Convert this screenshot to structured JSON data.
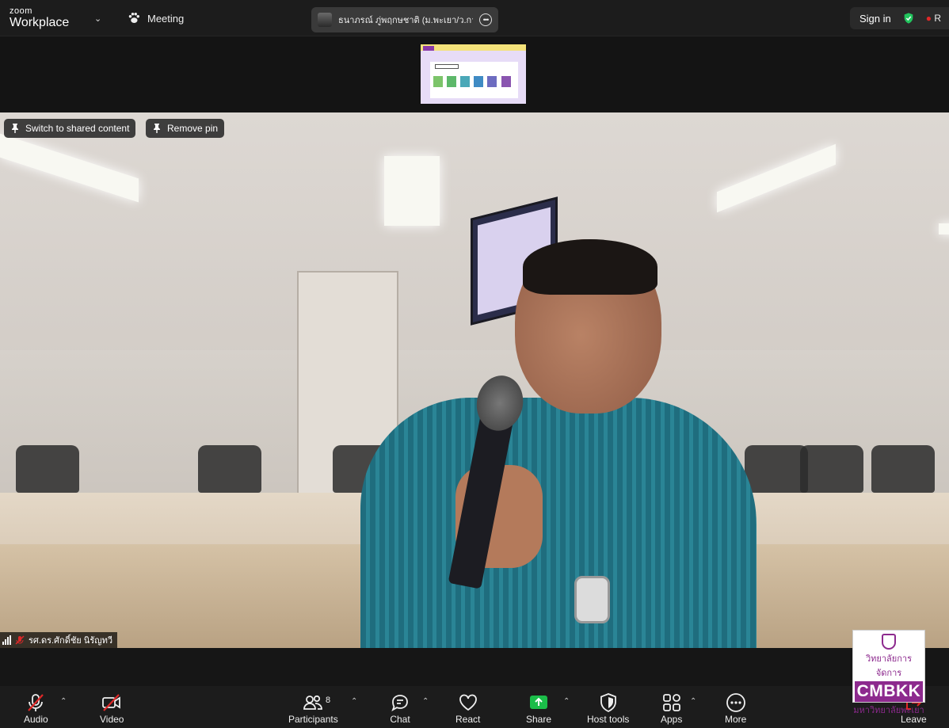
{
  "app": {
    "brand_small": "zoom",
    "brand_large": "Workplace"
  },
  "topbar": {
    "meeting_label": "Meeting",
    "active_speaker": "ธนาภรณ์ ภู่พฤกษชาติ (ม.พะเยา/ว.การ",
    "sign_in_label": "Sign in",
    "rec_label": "R"
  },
  "video": {
    "switch_shared_label": "Switch to shared content",
    "remove_pin_label": "Remove pin",
    "participant_name": "รศ.ดร.ศักดิ์ชัย นิรัญทวี"
  },
  "toolbar": {
    "audio_label": "Audio",
    "video_label": "Video",
    "participants_label": "Participants",
    "participants_count": "8",
    "chat_label": "Chat",
    "react_label": "React",
    "share_label": "Share",
    "host_tools_label": "Host tools",
    "apps_label": "Apps",
    "more_label": "More",
    "leave_label": "Leave"
  },
  "watermark": {
    "line1": "วิทยาลัยการจัดการ",
    "line2": "CMBKK",
    "line3": "มหาวิทยาลัยพะเยา"
  },
  "colors": {
    "share_green": "#1bbd49",
    "shield_green": "#22c55e",
    "leave_red": "#e02828",
    "brand_purple": "#8d2a8e"
  }
}
